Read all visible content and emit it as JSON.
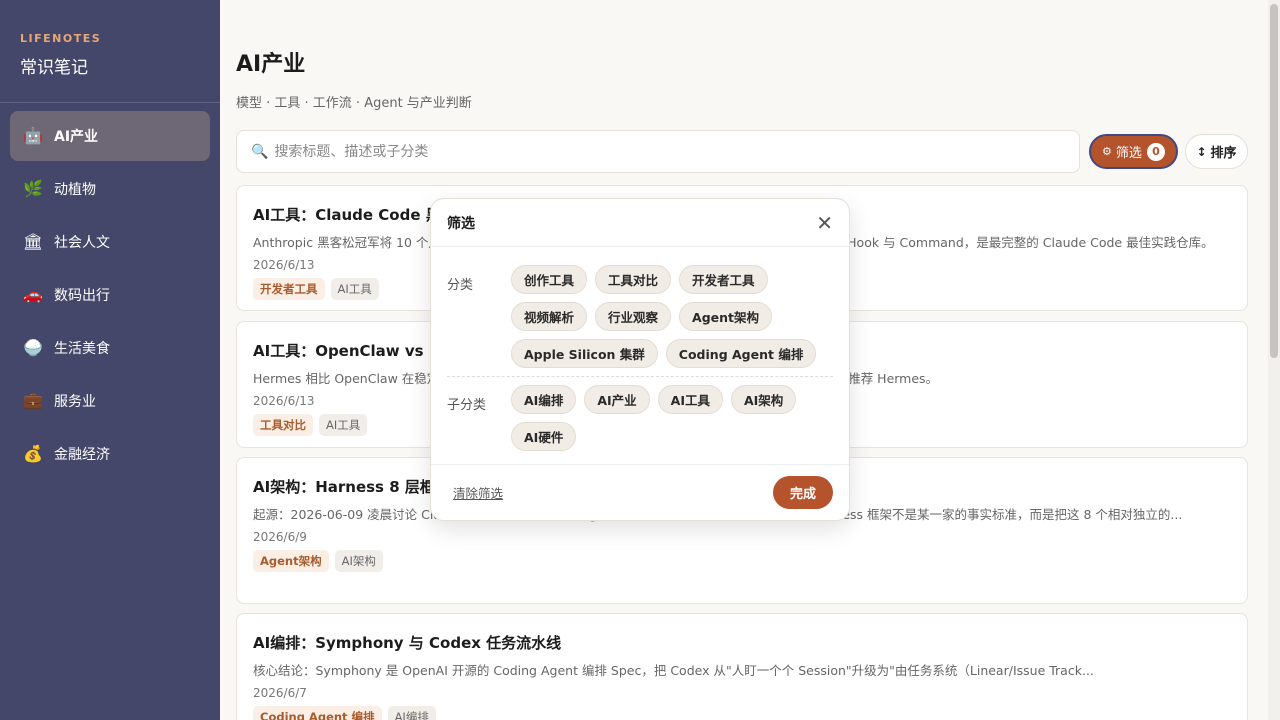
{
  "sidebar": {
    "brand_kicker": "LIFENOTES",
    "brand_title": "常识笔记",
    "items": [
      {
        "icon": "🤖",
        "label": "AI产业"
      },
      {
        "icon": "🌿",
        "label": "动植物"
      },
      {
        "icon": "🏛",
        "label": "社会人文"
      },
      {
        "icon": "🚗",
        "label": "数码出行"
      },
      {
        "icon": "🍚",
        "label": "生活美食"
      },
      {
        "icon": "💼",
        "label": "服务业"
      },
      {
        "icon": "💰",
        "label": "金融经济"
      }
    ]
  },
  "header": {
    "title": "AI产业",
    "subtitle": "模型 · 工具 · 工作流 · Agent 与产业判断"
  },
  "toolbar": {
    "search_placeholder": "搜索标题、描述或子分类",
    "filter_label": "筛选",
    "filter_count": "0",
    "sort_label": "排序"
  },
  "cards": [
    {
      "title": "AI工具：Claude Code 黑客松冠军",
      "desc": "Anthropic 黑客松冠军将 10 个月的实践整理成开源仓库 everything-claude-code，涵盖 Agent、Skill、Hook 与 Command，是最完整的 Claude Code 最佳实践仓库。",
      "date": "2026/6/13",
      "tags": [
        "开发者工具",
        "AI工具"
      ]
    },
    {
      "title": "AI工具：OpenClaw vs Hermes",
      "desc": "Hermes 相比 OpenClaw 在稳定性、记忆能力与易用性上都有提升；已经熟悉 OpenClaw 的不用换，新手推荐 Hermes。",
      "date": "2026/6/13",
      "tags": [
        "工具对比",
        "AI工具"
      ]
    },
    {
      "title": "AI架构：Harness 8 层框架",
      "desc": "起源：2026-06-09 凌晨讨论 Claude Code 与 Codex 等 Agent 运行环境时总结出的 8 个关键点。Harness 框架不是某一家的事实标准，而是把这 8 个相对独立的...",
      "date": "2026/6/9",
      "tags": [
        "Agent架构",
        "AI架构"
      ]
    },
    {
      "title": "AI编排：Symphony 与 Codex 任务流水线",
      "desc": "核心结论：Symphony 是 OpenAI 开源的 Coding Agent 编排 Spec，把 Codex 从\"人盯一个个 Session\"升级为\"由任务系统（Linear/Issue Track...",
      "date": "2026/6/7",
      "tags": [
        "Coding Agent 编排",
        "AI编排"
      ]
    }
  ],
  "filter_popup": {
    "title": "筛选",
    "category_label": "分类",
    "categories": [
      "创作工具",
      "工具对比",
      "开发者工具",
      "视频解析",
      "行业观察",
      "Agent架构",
      "Apple Silicon 集群",
      "Coding Agent 编排"
    ],
    "subcategory_label": "子分类",
    "subcategories": [
      "AI编排",
      "AI产业",
      "AI工具",
      "AI架构",
      "AI硬件"
    ],
    "clear_label": "清除筛选",
    "done_label": "完成"
  }
}
